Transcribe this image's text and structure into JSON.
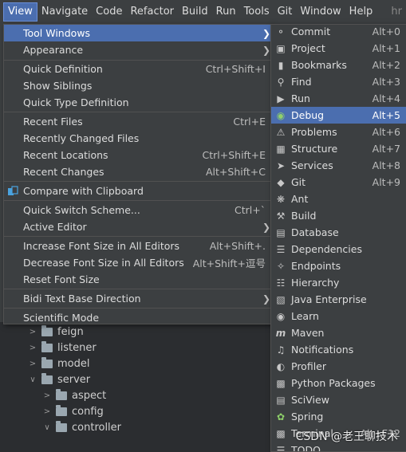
{
  "menubar": {
    "items": [
      "View",
      "Navigate",
      "Code",
      "Refactor",
      "Build",
      "Run",
      "Tools",
      "Git",
      "Window",
      "Help"
    ],
    "overflow_text": "hr"
  },
  "view_menu": {
    "items": [
      {
        "label": "Tool Windows",
        "shortcut": "",
        "submenu": true
      },
      {
        "label": "Appearance",
        "shortcut": "",
        "submenu": true
      },
      {
        "label": "Quick Definition",
        "shortcut": "Ctrl+Shift+I"
      },
      {
        "label": "Show Siblings",
        "shortcut": ""
      },
      {
        "label": "Quick Type Definition",
        "shortcut": ""
      },
      {
        "label": "Recent Files",
        "shortcut": "Ctrl+E"
      },
      {
        "label": "Recently Changed Files",
        "shortcut": ""
      },
      {
        "label": "Recent Locations",
        "shortcut": "Ctrl+Shift+E"
      },
      {
        "label": "Recent Changes",
        "shortcut": "Alt+Shift+C"
      },
      {
        "label": "Compare with Clipboard",
        "shortcut": ""
      },
      {
        "label": "Quick Switch Scheme...",
        "shortcut": "Ctrl+`"
      },
      {
        "label": "Active Editor",
        "shortcut": "",
        "submenu": true
      },
      {
        "label": "Increase Font Size in All Editors",
        "shortcut": "Alt+Shift+."
      },
      {
        "label": "Decrease Font Size in All Editors",
        "shortcut": "Alt+Shift+逗号"
      },
      {
        "label": "Reset Font Size",
        "shortcut": ""
      },
      {
        "label": "Bidi Text Base Direction",
        "shortcut": "",
        "submenu": true
      },
      {
        "label": "Scientific Mode",
        "shortcut": ""
      }
    ]
  },
  "tool_windows": {
    "items": [
      {
        "label": "Commit",
        "shortcut": "Alt+0",
        "icon": "commit-icon"
      },
      {
        "label": "Project",
        "shortcut": "Alt+1",
        "icon": "folder-icon"
      },
      {
        "label": "Bookmarks",
        "shortcut": "Alt+2",
        "icon": "bookmark-icon"
      },
      {
        "label": "Find",
        "shortcut": "Alt+3",
        "icon": "search-icon"
      },
      {
        "label": "Run",
        "shortcut": "Alt+4",
        "icon": "run-icon"
      },
      {
        "label": "Debug",
        "shortcut": "Alt+5",
        "icon": "debug-icon"
      },
      {
        "label": "Problems",
        "shortcut": "Alt+6",
        "icon": "problems-icon"
      },
      {
        "label": "Structure",
        "shortcut": "Alt+7",
        "icon": "structure-icon"
      },
      {
        "label": "Services",
        "shortcut": "Alt+8",
        "icon": "services-icon"
      },
      {
        "label": "Git",
        "shortcut": "Alt+9",
        "icon": "git-icon"
      },
      {
        "label": "Ant",
        "shortcut": "",
        "icon": "ant-icon"
      },
      {
        "label": "Build",
        "shortcut": "",
        "icon": "build-icon"
      },
      {
        "label": "Database",
        "shortcut": "",
        "icon": "database-icon"
      },
      {
        "label": "Dependencies",
        "shortcut": "",
        "icon": "dependencies-icon"
      },
      {
        "label": "Endpoints",
        "shortcut": "",
        "icon": "endpoints-icon"
      },
      {
        "label": "Hierarchy",
        "shortcut": "",
        "icon": "hierarchy-icon"
      },
      {
        "label": "Java Enterprise",
        "shortcut": "",
        "icon": "java-enterprise-icon"
      },
      {
        "label": "Learn",
        "shortcut": "",
        "icon": "learn-icon"
      },
      {
        "label": "Maven",
        "shortcut": "",
        "icon": "maven-icon"
      },
      {
        "label": "Notifications",
        "shortcut": "",
        "icon": "notifications-icon"
      },
      {
        "label": "Profiler",
        "shortcut": "",
        "icon": "profiler-icon"
      },
      {
        "label": "Python Packages",
        "shortcut": "",
        "icon": "python-packages-icon"
      },
      {
        "label": "SciView",
        "shortcut": "",
        "icon": "sciview-icon"
      },
      {
        "label": "Spring",
        "shortcut": "",
        "icon": "spring-icon"
      },
      {
        "label": "Terminal",
        "shortcut": "Alt+F12",
        "icon": "terminal-icon"
      },
      {
        "label": "TODO",
        "shortcut": "",
        "icon": "todo-icon"
      }
    ]
  },
  "project_tree": {
    "items": [
      "feign",
      "listener",
      "model",
      "server",
      "aspect",
      "config",
      "controller"
    ]
  },
  "watermark": "CSDN @老王聊技术",
  "colors": {
    "selection": "#4b6eaf",
    "menu_bg": "#3c3f41",
    "editor_bg": "#2b2d30"
  }
}
